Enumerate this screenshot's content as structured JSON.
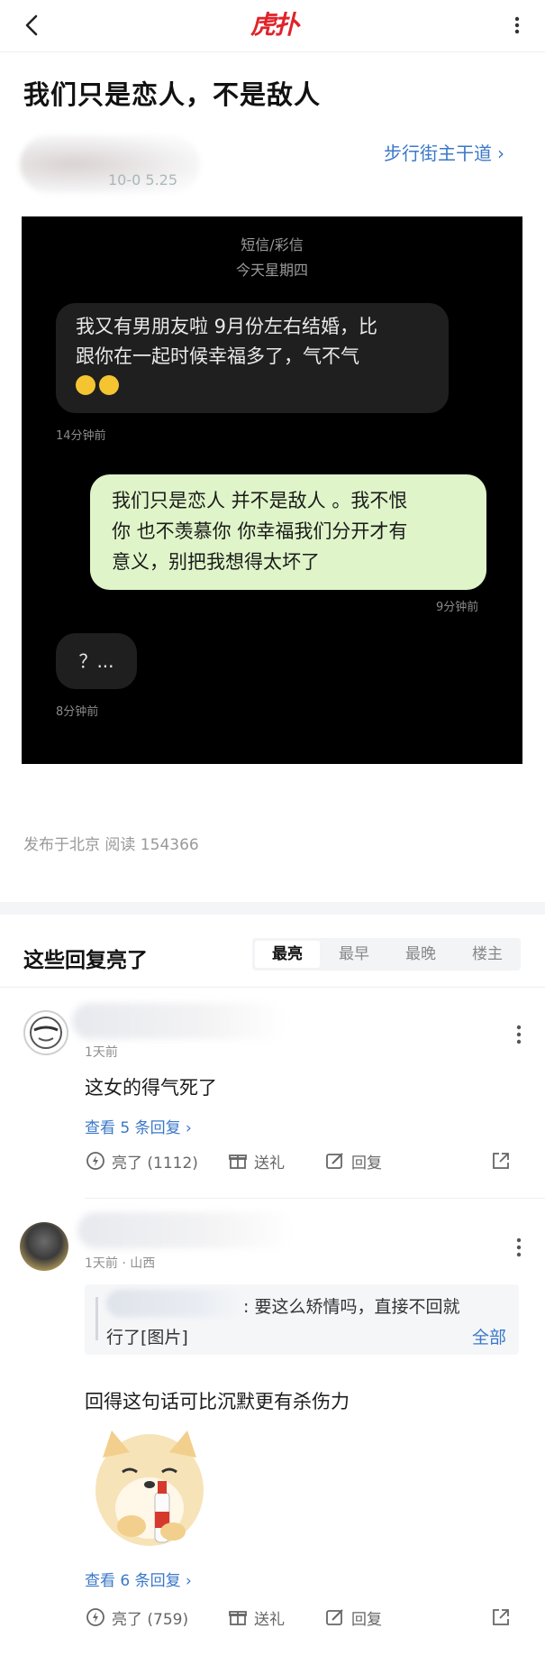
{
  "topbar": {
    "logo_text": "虎扑"
  },
  "post": {
    "title": "我们只是恋人，不是敌人",
    "author_time": "10-0 5.25",
    "forum_link": "步行街主干道",
    "meta": "发布于北京  阅读 154366"
  },
  "sms": {
    "header_line1": "短信/彩信",
    "header_line2": "今天星期四",
    "msg1_line1": "我又有男朋友啦 9月份左右结婚，比",
    "msg1_line2": "跟你在一起时候幸福多了，气不气",
    "msg1_time": "14分钟前",
    "msg2_line1": "我们只是恋人 并不是敌人 。我不恨",
    "msg2_line2": "你 也不羡慕你 你幸福我们分开才有",
    "msg2_line3": "意义，别把我想得太坏了",
    "msg2_time": "9分钟前",
    "msg3": "？...",
    "msg3_time": "8分钟前"
  },
  "replies": {
    "title": "这些回复亮了",
    "sort_tabs": [
      "最亮",
      "最早",
      "最晚",
      "楼主"
    ],
    "active_tab": "最亮"
  },
  "comments": [
    {
      "meta": "1天前",
      "text": "这女的得气死了",
      "view_replies": "查看 5 条回复",
      "light": "亮了 (1112)",
      "gift": "送礼",
      "reply": "回复"
    },
    {
      "meta": "1天前 · 山西",
      "quote_text": ": 要这么矫情吗，直接不回就",
      "quote_text2": "行了[图片]",
      "quote_all": "全部",
      "text": "回得这句话可比沉默更有杀伤力",
      "view_replies": "查看 6 条回复",
      "light": "亮了 (759)",
      "gift": "送礼",
      "reply": "回复"
    }
  ],
  "colors": {
    "brand": "#e0232a",
    "link": "#3a78c8",
    "bubble_out": "#dff5c9"
  }
}
